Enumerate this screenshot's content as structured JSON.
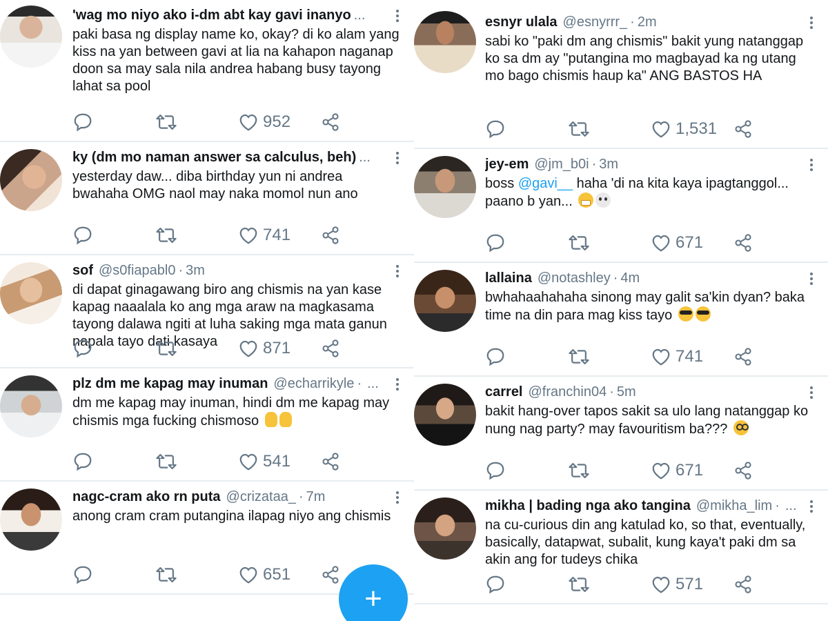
{
  "colors": {
    "accent": "#1da1f2",
    "text": "#14171a",
    "muted": "#657786",
    "divider": "#e6ecf0"
  },
  "icons": {
    "reply": "speech-bubble-icon",
    "retweet": "retweet-icon",
    "like": "heart-icon",
    "share": "share-icon",
    "more": "vertical-dots-icon",
    "compose": "plus-icon"
  },
  "compose_label": "+",
  "left_tweets": [
    {
      "name": "'wag mo niyo ako i-dm abt kay gavi inanyo",
      "handle": "",
      "time": "",
      "tail": "...",
      "text": "paki basa ng display name ko, okay? di ko alam yang kiss na yan between gavi at lia na kahapon naganap doon sa may sala nila andrea habang busy tayong lahat sa pool",
      "likes": "952"
    },
    {
      "name": "ky (dm mo naman answer sa calculus, beh)",
      "handle": "",
      "time": "",
      "tail": "...",
      "text": "yesterday daw... diba birthday yun ni andrea bwahaha OMG naol may naka momol nun ano",
      "likes": "741"
    },
    {
      "name": "sof",
      "handle": "@s0fiapabl0",
      "time": "3m",
      "tail": "",
      "text": "di dapat ginagawang biro ang chismis na yan kase kapag naaalala ko ang mga araw na magkasama tayong dalawa ngiti at luha saking mga mata ganun napala tayo dati kasaya",
      "likes": "871"
    },
    {
      "name": "plz dm me kapag may inuman",
      "handle": "@echarrikyle",
      "time": "",
      "tail": "...",
      "text": "dm me kapag may inuman, hindi dm me kapag may chismis mga fucking chismoso",
      "likes": "541"
    },
    {
      "name": "nagc-cram ako rn puta",
      "handle": "@crizataa_",
      "time": "7m",
      "tail": "",
      "text": "anong cram cram putangina ilapag niyo ang chismis",
      "likes": "651"
    }
  ],
  "right_tweets": [
    {
      "name": "esnyr ulala",
      "handle": "@esnyrrr_",
      "time": "2m",
      "tail": "",
      "text": "sabi ko \"paki dm ang chismis\" bakit yung natanggap ko sa dm ay \"putangina mo magbayad ka ng utang mo bago chismis haup ka\" ANG BASTOS HA",
      "likes": "1,531"
    },
    {
      "name": "jey-em",
      "handle": "@jm_b0i",
      "time": "3m",
      "tail": "",
      "text_before": "boss ",
      "mention": "@gavi__",
      "text_after": " haha 'di na kita kaya ipagtanggol... paano b yan...",
      "likes": "671"
    },
    {
      "name": "lallaina",
      "handle": "@notashley",
      "time": "4m",
      "tail": "",
      "text": "bwhahaahahaha sinong may galit sa'kin dyan? baka time na din para mag kiss tayo",
      "likes": "741"
    },
    {
      "name": "carrel",
      "handle": "@franchin04",
      "time": "5m",
      "tail": "",
      "text": "bakit hang-over tapos sakit sa ulo lang natanggap ko nung nag party? may favouritism ba???",
      "likes": "671"
    },
    {
      "name": "mikha | bading nga ako tangina",
      "handle": "@mikha_lim",
      "time": "",
      "tail": "...",
      "text": "na cu-curious din ang katulad ko, so that, eventually, basically, datapwat, subalit, kung kaya't paki dm sa akin ang for tudeys chika",
      "likes": "571"
    }
  ]
}
